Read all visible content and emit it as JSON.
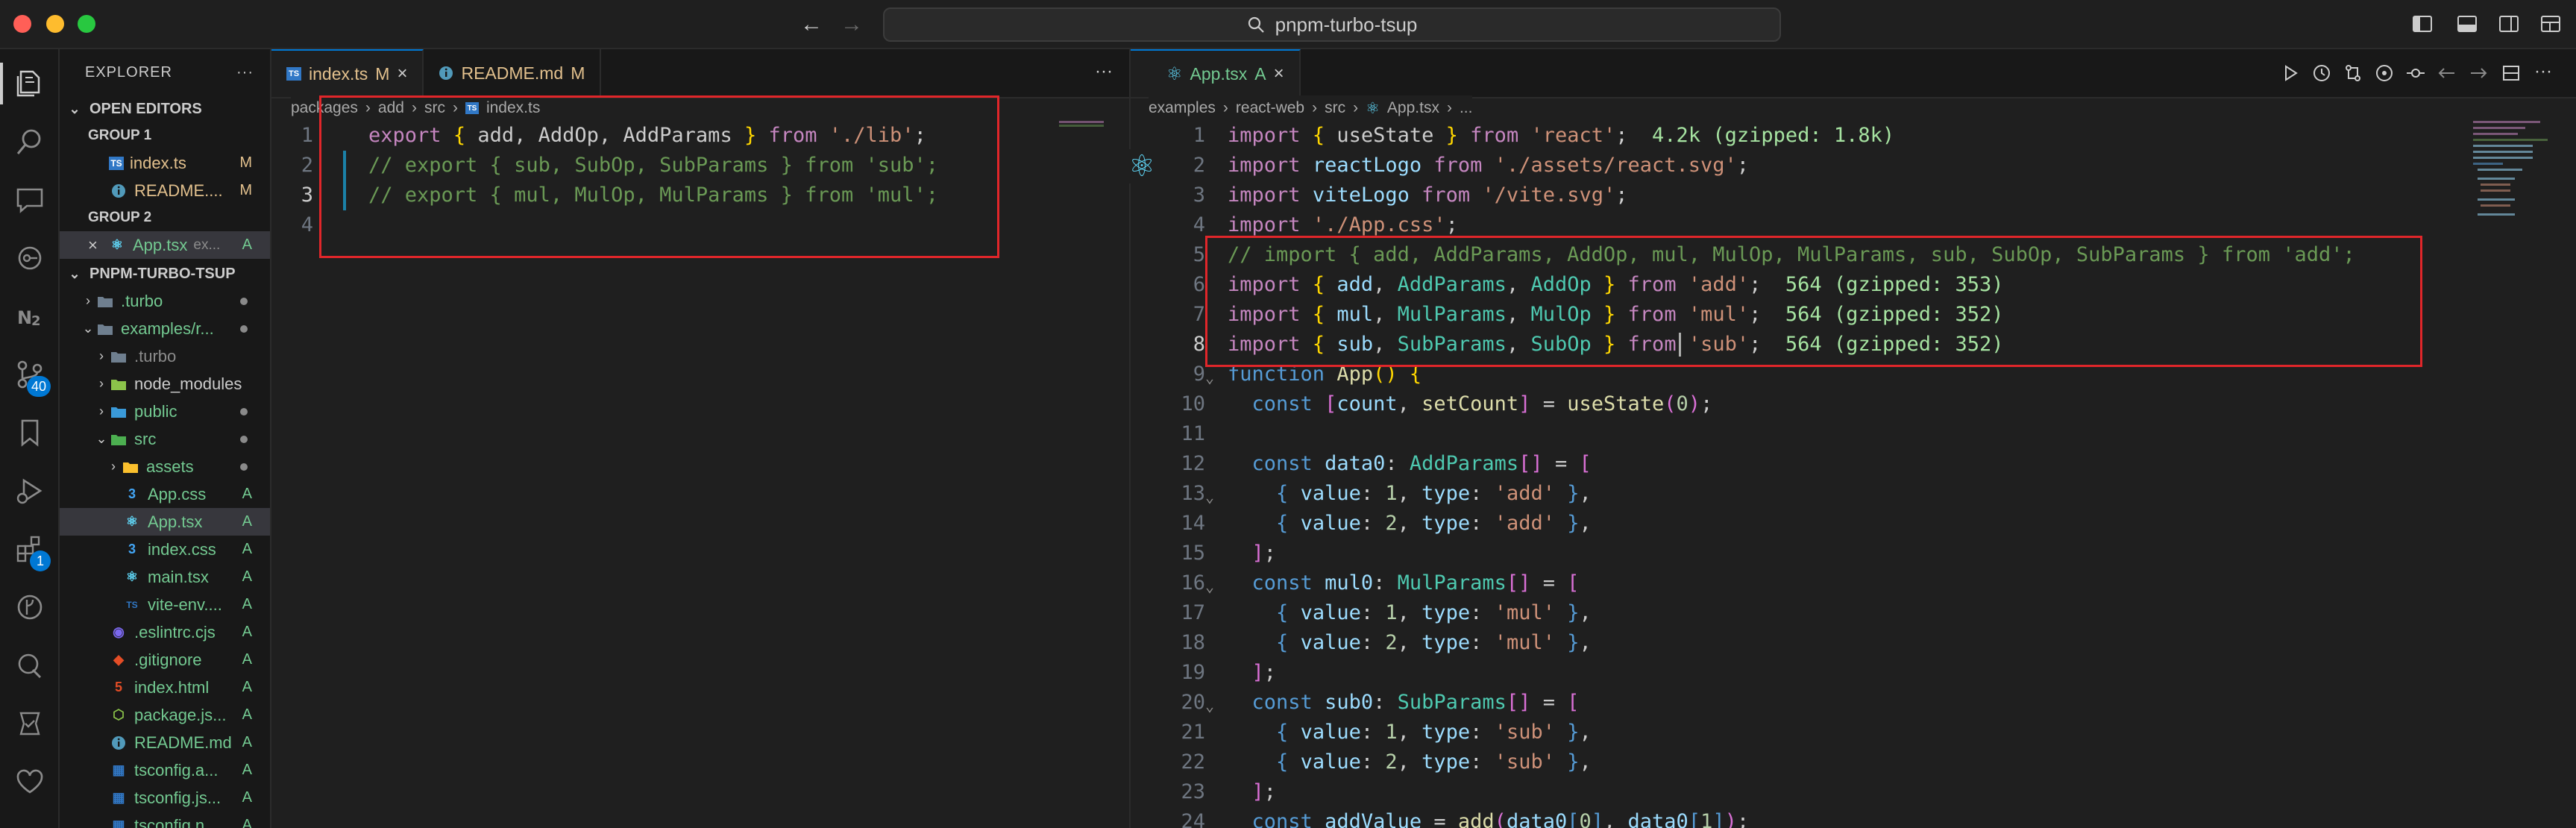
{
  "window": {
    "search_text": "pnpm-turbo-tsup",
    "traffic_colors": [
      "#ff5f57",
      "#febc2e",
      "#28c840"
    ]
  },
  "activity": {
    "scm_badge": "40",
    "ext_badge": "1"
  },
  "explorer": {
    "title": "EXPLORER",
    "more": "···",
    "open_editors_label": "OPEN EDITORS",
    "group1_label": "GROUP 1",
    "group2_label": "GROUP 2",
    "group1_items": [
      {
        "name": "index.ts",
        "status": "M"
      },
      {
        "name": "README....",
        "status": "M"
      }
    ],
    "group2_items": [
      {
        "name": "App.tsx",
        "desc": "ex...",
        "status": "A"
      }
    ],
    "project_label": "PNPM-TURBO-TSUP",
    "tree": [
      {
        "name": ".turbo"
      },
      {
        "name": "examples/r..."
      },
      {
        "name": ".turbo"
      },
      {
        "name": "node_modules"
      },
      {
        "name": "public"
      },
      {
        "name": "src"
      },
      {
        "name": "assets"
      },
      {
        "name": "App.css",
        "status": "A"
      },
      {
        "name": "App.tsx",
        "status": "A"
      },
      {
        "name": "index.css",
        "status": "A"
      },
      {
        "name": "main.tsx",
        "status": "A"
      },
      {
        "name": "vite-env....",
        "status": "A"
      },
      {
        "name": ".eslintrc.cjs",
        "status": "A"
      },
      {
        "name": ".gitignore",
        "status": "A"
      },
      {
        "name": "index.html",
        "status": "A"
      },
      {
        "name": "package.js...",
        "status": "A"
      },
      {
        "name": "README.md",
        "status": "A"
      },
      {
        "name": "tsconfig.a...",
        "status": "A"
      },
      {
        "name": "tsconfig.js...",
        "status": "A"
      },
      {
        "name": "tsconfig.n...",
        "status": "A"
      }
    ]
  },
  "left_editor": {
    "tabs": [
      {
        "name": "index.ts",
        "status": "M"
      },
      {
        "name": "README.md",
        "status": "M"
      }
    ],
    "more": "···",
    "breadcrumb": [
      "packages",
      "add",
      "src",
      "index.ts"
    ],
    "lines": [
      "1",
      "2",
      "3",
      "4"
    ],
    "code": [
      "export { add, AddOp, AddParams } from './lib';",
      "// export { sub, SubOp, SubParams } from 'sub';",
      "// export { mul, MulOp, MulParams } from 'mul';"
    ]
  },
  "right_editor": {
    "tab": {
      "name": "App.tsx",
      "status": "A"
    },
    "breadcrumb": [
      "examples",
      "react-web",
      "src",
      "App.tsx",
      "..."
    ],
    "lines": [
      "1",
      "2",
      "3",
      "4",
      "5",
      "6",
      "7",
      "8",
      "9",
      "10",
      "11",
      "12",
      "13",
      "14",
      "15",
      "16",
      "17",
      "18",
      "19",
      "20",
      "21",
      "22",
      "23",
      "24"
    ],
    "code": {
      "l1": {
        "a": "import",
        "b": "{ useState }",
        "c": "from",
        "d": "'react'",
        "e": ";",
        "hint": "4.2k (gzipped: 1.8k)"
      },
      "l2": "import reactLogo from './assets/react.svg';",
      "l3": "import viteLogo from '/vite.svg';",
      "l4": "import './App.css';",
      "l5": "// import { add, AddParams, AddOp, mul, MulOp, MulParams, sub, SubOp, SubParams } from 'add';",
      "l6": {
        "text": "import { add, AddParams, AddOp } from 'add';",
        "hint": "564 (gzipped: 353)"
      },
      "l7": {
        "text": "import { mul, MulParams, MulOp } from 'mul';",
        "hint": "564 (gzipped: 352)"
      },
      "l8": {
        "text": "import { sub, SubParams, SubOp } from 'sub';",
        "hint": "564 (gzipped: 352)"
      },
      "l9": "function App() {",
      "l10": "  const [count, setCount] = useState(0);",
      "l11": "",
      "l12": "  const data0: AddParams[] = [",
      "l13": "    { value: 1, type: 'add' },",
      "l14": "    { value: 2, type: 'add' },",
      "l15": "  ];",
      "l16": "  const mul0: MulParams[] = [",
      "l17": "    { value: 1, type: 'mul' },",
      "l18": "    { value: 2, type: 'mul' },",
      "l19": "  ];",
      "l20": "  const sub0: SubParams[] = [",
      "l21": "    { value: 1, type: 'sub' },",
      "l22": "    { value: 2, type: 'sub' },",
      "l23": "  ];",
      "l24": "  const addValue = add(data0[0], data0[1]);"
    }
  }
}
